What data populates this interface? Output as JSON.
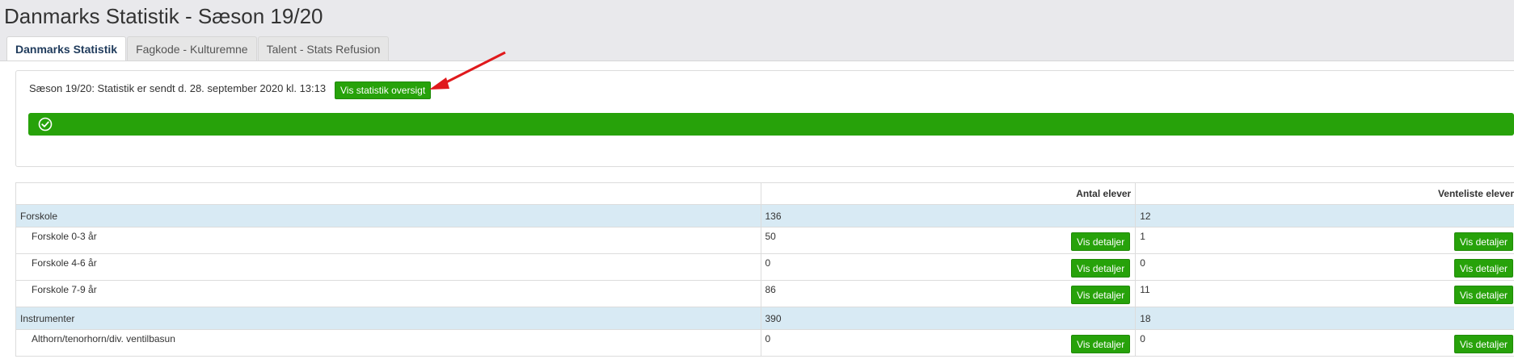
{
  "page": {
    "title": "Danmarks Statistik - Sæson 19/20"
  },
  "tabs": [
    {
      "label": "Danmarks Statistik",
      "active": true
    },
    {
      "label": "Fagkode - Kulturemne",
      "active": false
    },
    {
      "label": "Talent - Stats Refusion",
      "active": false
    }
  ],
  "status": {
    "text": "Sæson 19/20: Statistik er sendt d. 28. september 2020 kl. 13:13",
    "button_label": "Vis statistik oversigt",
    "progress_icon": "check-circle-icon",
    "progress_color": "#27a20a",
    "progress_value": 1.0
  },
  "annotation": {
    "arrow_color": "#e0191c"
  },
  "table": {
    "headers": [
      "",
      "Antal elever",
      "Venteliste elever"
    ],
    "detail_label": "Vis detaljer",
    "rows": [
      {
        "type": "group",
        "name": "Forskole",
        "antal": "136",
        "venteliste": "12"
      },
      {
        "type": "item",
        "name": "Forskole 0-3 år",
        "antal": "50",
        "venteliste": "1"
      },
      {
        "type": "item",
        "name": "Forskole 4-6 år",
        "antal": "0",
        "venteliste": "0"
      },
      {
        "type": "item",
        "name": "Forskole 7-9 år",
        "antal": "86",
        "venteliste": "11"
      },
      {
        "type": "group",
        "name": "Instrumenter",
        "antal": "390",
        "venteliste": "18"
      },
      {
        "type": "item",
        "name": "Althorn/tenorhorn/div. ventilbasun",
        "antal": "0",
        "venteliste": "0"
      }
    ]
  }
}
